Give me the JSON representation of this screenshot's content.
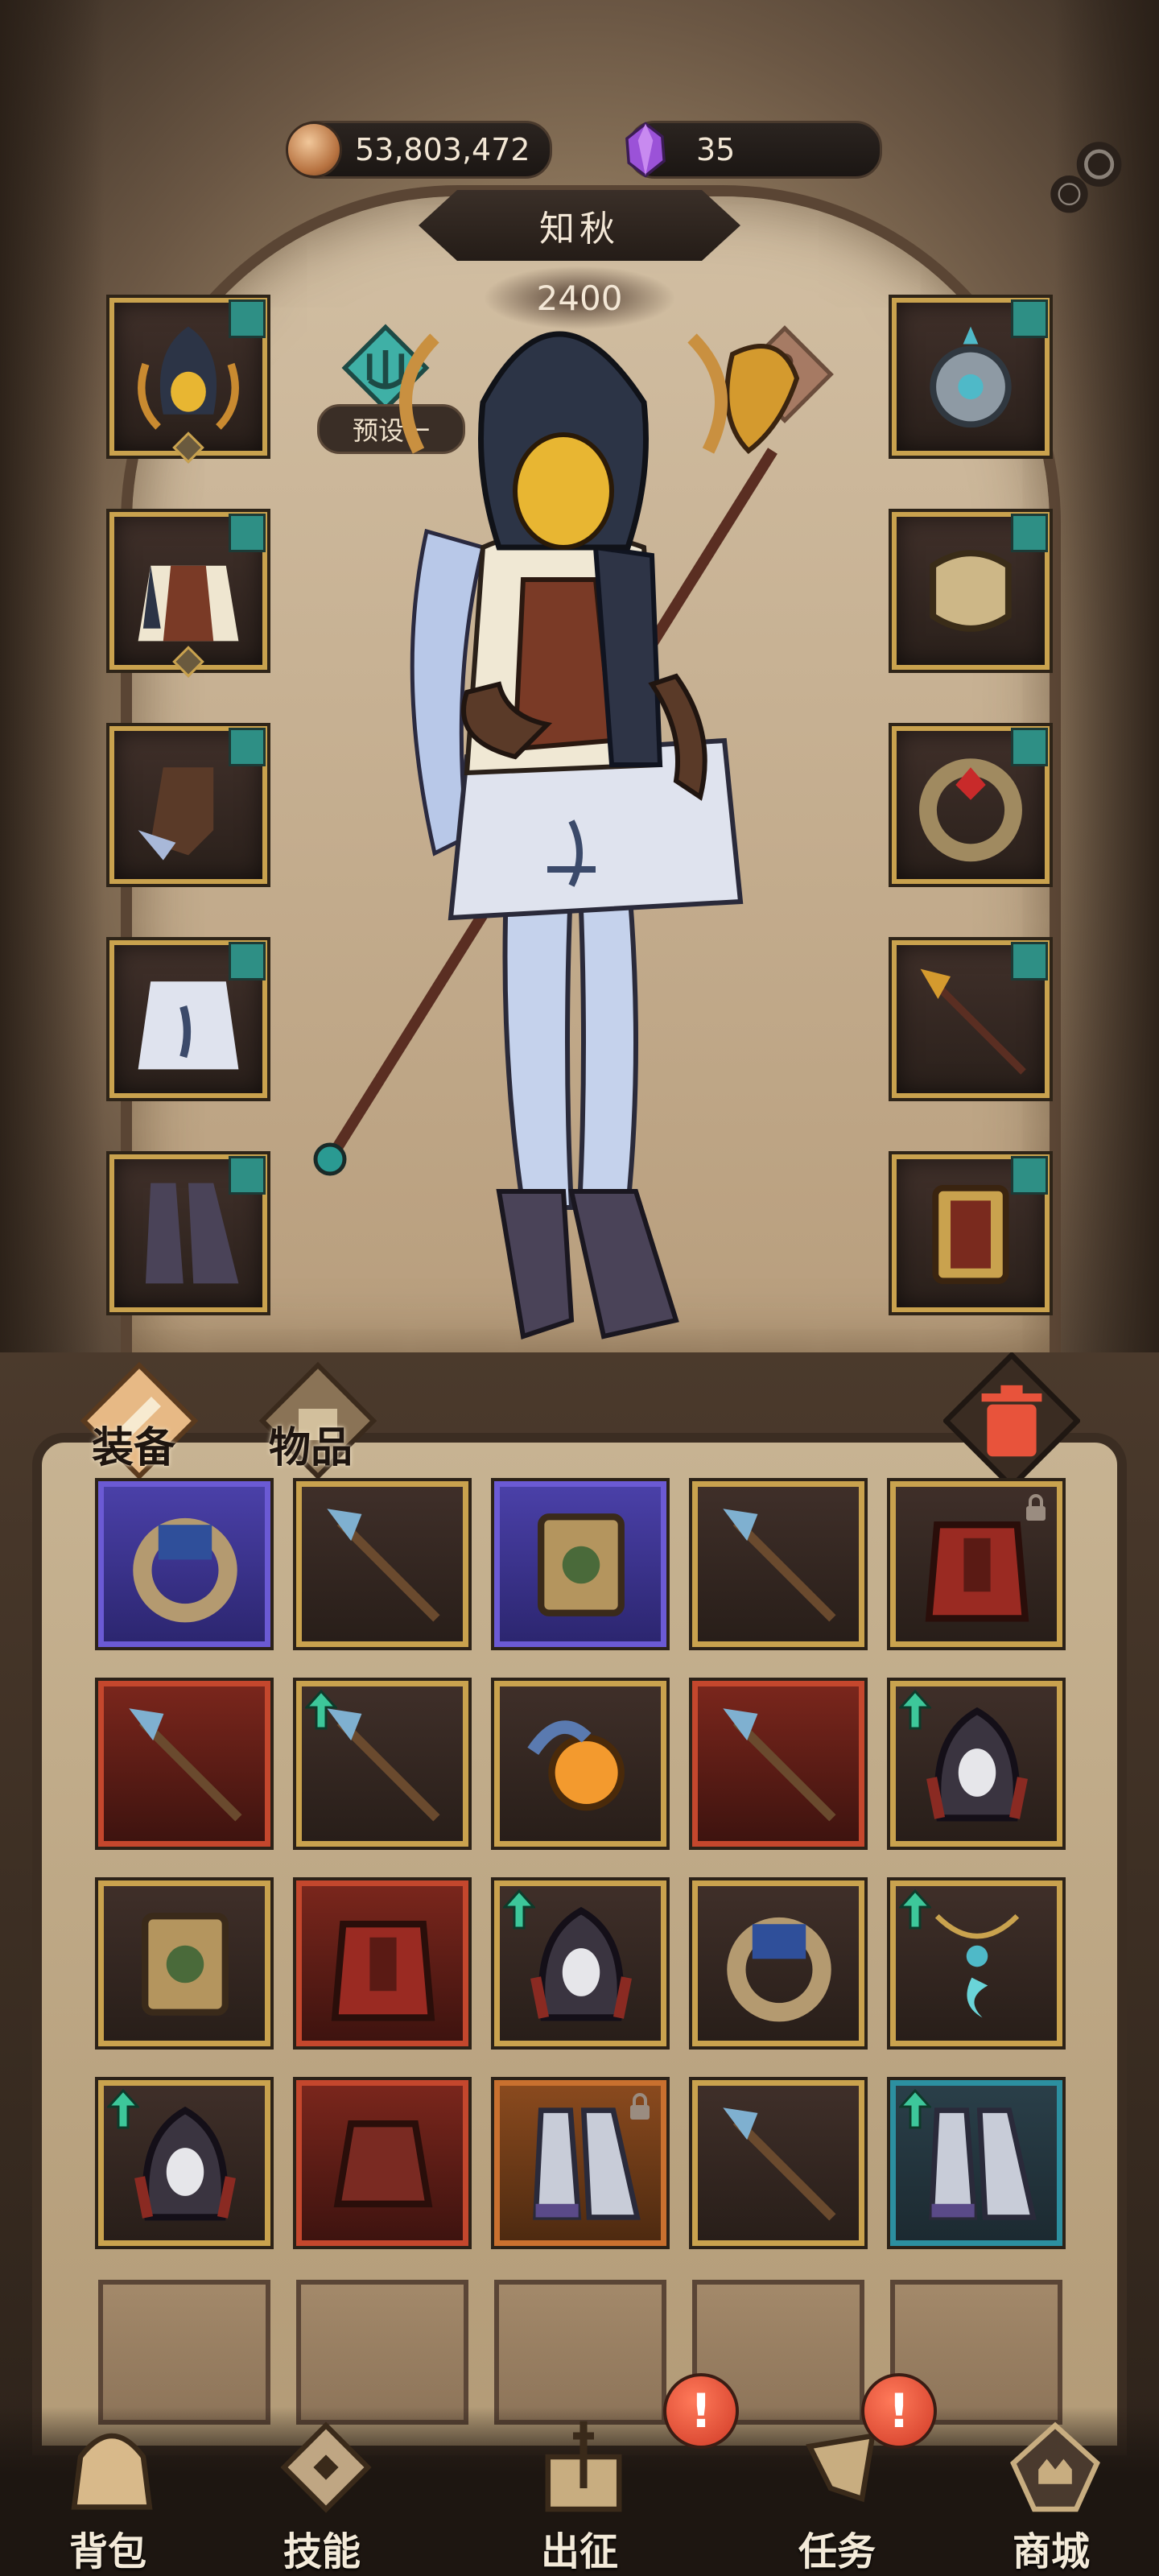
{
  "currency": {
    "gold": "53,803,472",
    "gems": "35"
  },
  "hero": {
    "name": "知秋",
    "power": "2400",
    "preset_label": "预设一"
  },
  "equipment_slots": {
    "left": [
      "hood-helmet",
      "shirt-armor",
      "gauntlet",
      "robe-skirt",
      "boots"
    ],
    "right": [
      "amulet",
      "fist-gloves",
      "ring",
      "staff",
      "spellbook"
    ]
  },
  "inventory": {
    "tabs": [
      "装备",
      "物品"
    ],
    "cells": [
      {
        "icon": "ring-icon",
        "rarity": "purple"
      },
      {
        "icon": "staff-icon",
        "rarity": "gold"
      },
      {
        "icon": "book-icon",
        "rarity": "purple"
      },
      {
        "icon": "staff-icon",
        "rarity": "gold"
      },
      {
        "icon": "armor-icon",
        "rarity": "gold",
        "locked": true
      },
      {
        "icon": "staff-icon",
        "rarity": "red"
      },
      {
        "icon": "staff-icon",
        "rarity": "gold",
        "upgrade": true
      },
      {
        "icon": "orb-icon",
        "rarity": "gold"
      },
      {
        "icon": "staff-icon",
        "rarity": "red"
      },
      {
        "icon": "hood-icon",
        "rarity": "gold",
        "upgrade": true
      },
      {
        "icon": "book-icon",
        "rarity": "gold"
      },
      {
        "icon": "armor-icon",
        "rarity": "red"
      },
      {
        "icon": "hood-icon",
        "rarity": "gold",
        "upgrade": true
      },
      {
        "icon": "ring-icon",
        "rarity": "gold"
      },
      {
        "icon": "amulet-icon",
        "rarity": "gold",
        "upgrade": true
      },
      {
        "icon": "hood-icon",
        "rarity": "gold",
        "upgrade": true
      },
      {
        "icon": "hat-icon",
        "rarity": "red"
      },
      {
        "icon": "boots-icon",
        "rarity": "orange",
        "locked": true
      },
      {
        "icon": "staff-icon",
        "rarity": "gold"
      },
      {
        "icon": "boots-icon",
        "rarity": "teal",
        "upgrade": true
      },
      {
        "icon": "empty"
      },
      {
        "icon": "empty"
      },
      {
        "icon": "empty"
      },
      {
        "icon": "empty"
      },
      {
        "icon": "empty"
      }
    ]
  },
  "nav": {
    "bag": "背包",
    "skills": "技能",
    "expedition": "出征",
    "quests": "任务",
    "shop": "商城",
    "quest_badge": "!",
    "expedition_badge": "!"
  },
  "colors": {
    "gold_frame": "#c9a24e",
    "purple_frame": "#6b5ad4",
    "red_frame": "#c4472d",
    "teal_tag": "#2e8f85"
  }
}
